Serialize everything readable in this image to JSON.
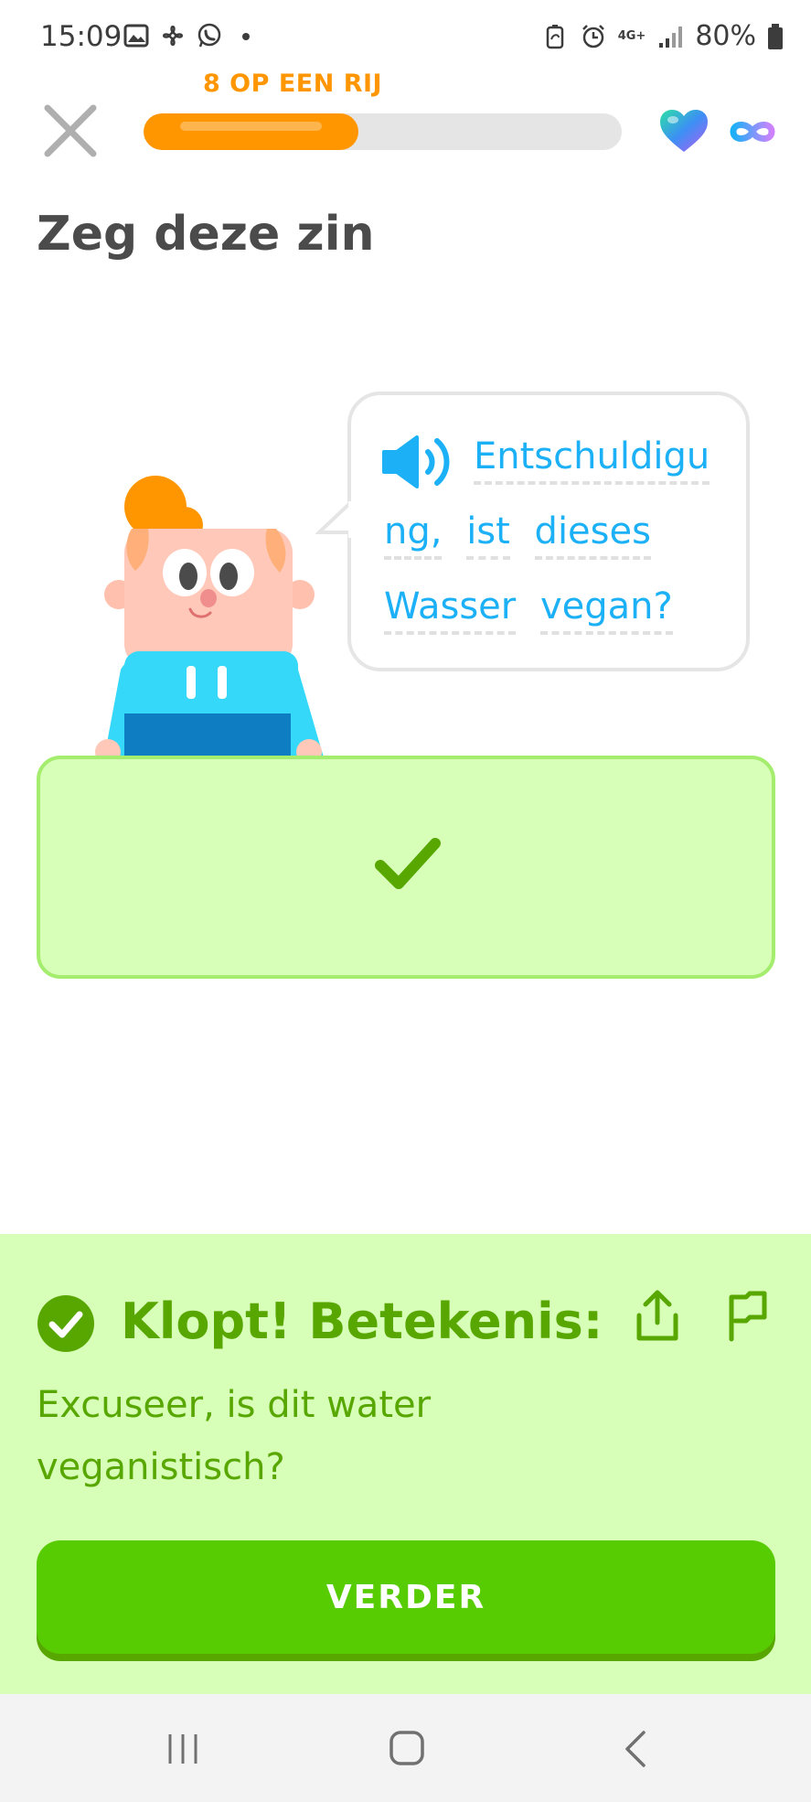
{
  "status_bar": {
    "time": "15:09",
    "left_icons": [
      "gallery-icon",
      "pinwheel-icon",
      "whatsapp-icon",
      "dot-icon"
    ],
    "right_icons": [
      "battery-saver-icon",
      "alarm-icon",
      "4g-icon",
      "signal-icon",
      "battery-icon"
    ],
    "network": "4G+",
    "battery": "80%"
  },
  "top_bar": {
    "streak_label": "8 OP EEN RIJ",
    "progress_fraction": 0.45,
    "hearts": "infinite"
  },
  "exercise": {
    "title": "Zeg deze zin",
    "sentence_lines": [
      [
        "Entschuldigu"
      ],
      [
        "ng,",
        "ist",
        "dieses"
      ],
      [
        "Wasser",
        "vegan?"
      ]
    ]
  },
  "feedback": {
    "title": "Klopt! Betekenis:",
    "meaning": "Excuseer, is dit water veganistisch?",
    "continue_label": "VERDER"
  },
  "colors": {
    "accent_orange": "#ff9600",
    "correct_green": "#58cc02",
    "correct_text": "#58a700",
    "panel_bg": "#d7ffb8",
    "link_blue": "#1cb0f6"
  }
}
